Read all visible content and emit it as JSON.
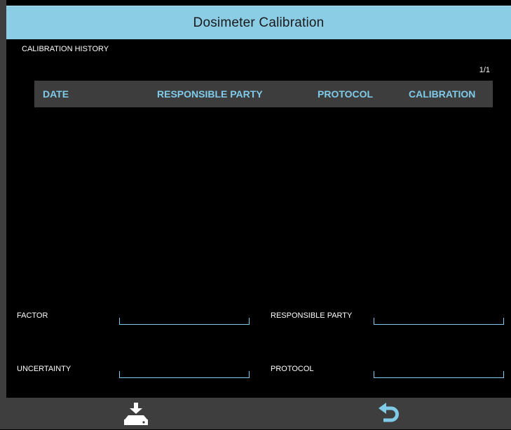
{
  "window": {
    "title": "Dosimeter Calibration"
  },
  "history": {
    "section_label": "CALIBRATION HISTORY",
    "page_indicator": "1/1",
    "columns": [
      "DATE",
      "RESPONSIBLE PARTY",
      "PROTOCOL",
      "CALIBRATION"
    ],
    "rows": []
  },
  "form": {
    "factor_label": "FACTOR",
    "factor_value": "",
    "uncertainty_label": "UNCERTAINTY",
    "uncertainty_value": "",
    "responsible_party_label": "RESPONSIBLE PARTY",
    "responsible_party_value": "",
    "protocol_label": "PROTOCOL",
    "protocol_value": ""
  },
  "toolbar": {
    "save_icon": "download-tray-icon",
    "back_icon": "return-arrow-icon"
  },
  "colors": {
    "accent": "#7fcbe9",
    "title_bar": "#8ccde6",
    "panel": "#3e3e3e",
    "background": "#000000"
  }
}
